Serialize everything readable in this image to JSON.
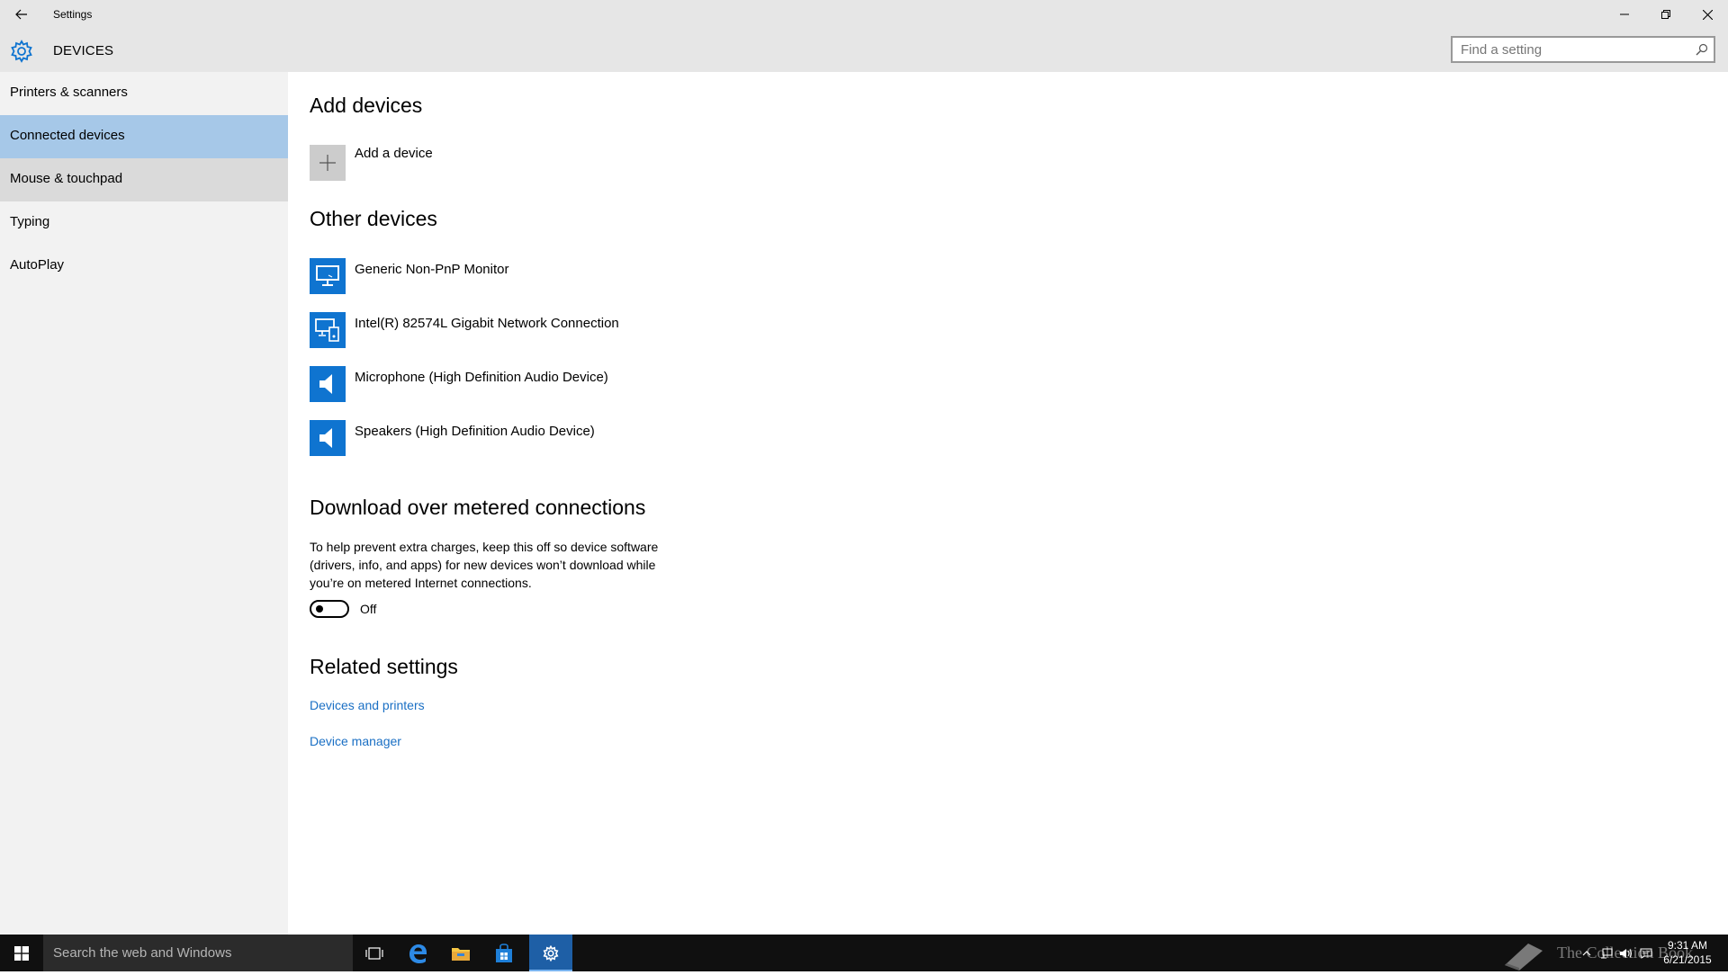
{
  "window": {
    "title": "Settings"
  },
  "header": {
    "title": "DEVICES",
    "search_placeholder": "Find a setting"
  },
  "sidebar": {
    "items": [
      {
        "label": "Printers & scanners",
        "state": "normal"
      },
      {
        "label": "Connected devices",
        "state": "selected"
      },
      {
        "label": "Mouse & touchpad",
        "state": "hover"
      },
      {
        "label": "Typing",
        "state": "normal"
      },
      {
        "label": "AutoPlay",
        "state": "normal"
      }
    ]
  },
  "main": {
    "add_devices": {
      "title": "Add devices",
      "add_label": "Add a device",
      "icon": "plus-icon"
    },
    "other_devices": {
      "title": "Other devices",
      "items": [
        {
          "label": "Generic Non-PnP Monitor",
          "icon": "monitor-icon"
        },
        {
          "label": "Intel(R) 82574L Gigabit Network Connection",
          "icon": "network-device-icon"
        },
        {
          "label": "Microphone (High Definition Audio Device)",
          "icon": "speaker-icon"
        },
        {
          "label": "Speakers (High Definition Audio Device)",
          "icon": "speaker-icon"
        }
      ]
    },
    "metered": {
      "title": "Download over metered connections",
      "description": "To help prevent extra charges, keep this off so device software (drivers, info, and apps) for new devices won’t download while you’re on metered Internet connections.",
      "toggle_state": "Off"
    },
    "related": {
      "title": "Related settings",
      "links": [
        "Devices and printers",
        "Device manager"
      ]
    }
  },
  "taskbar": {
    "search_placeholder": "Search the web and Windows",
    "clock_time": "9:31 AM",
    "clock_date": "6/21/2015",
    "watermark": "The Collection Book"
  },
  "colors": {
    "accent": "#0f74d0",
    "selected_nav": "#a6c8e8",
    "link": "#1a6fc4"
  }
}
